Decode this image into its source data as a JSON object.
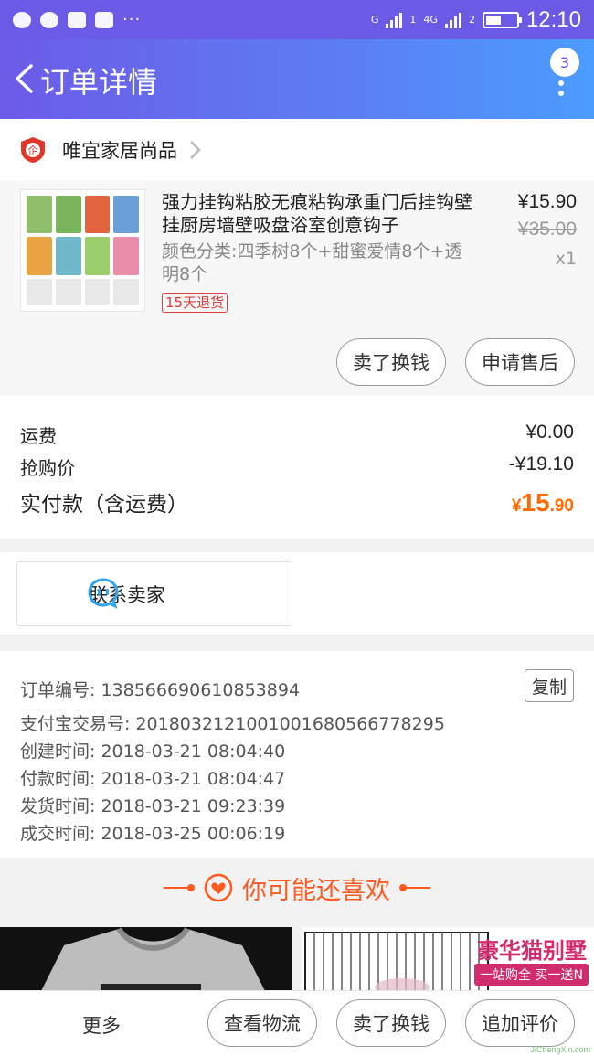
{
  "status_bar": {
    "time": "12:10",
    "network_label": "4G",
    "sim1": "1",
    "sim2": "2",
    "carrier_prefix": "G"
  },
  "navbar": {
    "title": "订单详情",
    "badge_count": "3"
  },
  "shop": {
    "name": "唯宜家居尚品"
  },
  "product": {
    "title": "强力挂钩粘胶无痕粘钩承重门后挂钩壁挂厨房墙壁吸盘浴室创意钩子",
    "spec": "颜色分类:四季树8个+甜蜜爱情8个+透明8个",
    "tag": "15天退货",
    "price": "¥15.90",
    "original_price": "¥35.00",
    "quantity": "x1",
    "btn_sell": "卖了换钱",
    "btn_after_sale": "申请售后"
  },
  "costs": {
    "shipping_label": "运费",
    "shipping_value": "¥0.00",
    "flash_label": "抢购价",
    "flash_value": "-¥19.10",
    "paid_label": "实付款（含运费）",
    "paid_symbol": "¥",
    "paid_int": "15",
    "paid_dec": ".90"
  },
  "contact": {
    "label": "联系卖家"
  },
  "order_info": {
    "order_no": "订单编号: 138566690610853894",
    "alipay_no": "支付宝交易号: 2018032121001001680566778295",
    "created": "创建时间: 2018-03-21 08:04:40",
    "paid": "付款时间: 2018-03-21 08:04:47",
    "shipped": "发货时间: 2018-03-21 09:23:39",
    "completed": "成交时间: 2018-03-25 00:06:19",
    "copy_label": "复制"
  },
  "recommend": {
    "title": "你可能还喜欢",
    "ad_title": "豪华猫别墅",
    "ad_sub": "一站购全 买一送N"
  },
  "bottom_bar": {
    "more": "更多",
    "btn_logistics": "查看物流",
    "btn_sell": "卖了换钱",
    "btn_review": "追加评价"
  },
  "watermark": "JiChengXin.com",
  "colors": {
    "accent_purple": "#6a5ae6",
    "price_orange": "#ff6a00",
    "tag_red": "#e23b3b",
    "recommend_orange": "#ff5a1f"
  }
}
